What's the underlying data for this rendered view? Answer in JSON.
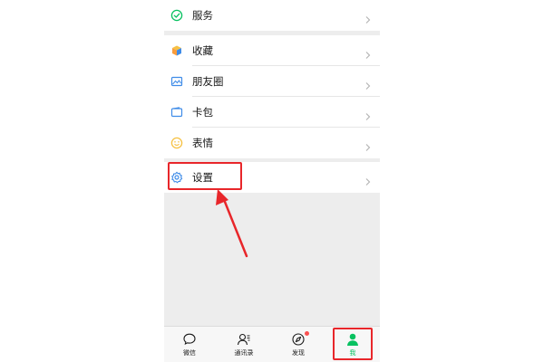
{
  "menu": {
    "group1": [
      {
        "label": "服务",
        "icon": "check-circle-icon"
      }
    ],
    "group2": [
      {
        "label": "收藏",
        "icon": "cube-icon"
      },
      {
        "label": "朋友圈",
        "icon": "image-icon"
      },
      {
        "label": "卡包",
        "icon": "wallet-icon"
      },
      {
        "label": "表情",
        "icon": "smiley-icon"
      }
    ],
    "group3": [
      {
        "label": "设置",
        "icon": "gear-icon"
      }
    ]
  },
  "tabbar": {
    "tabs": [
      {
        "label": "微信",
        "icon": "chat-bubble-icon",
        "active": false
      },
      {
        "label": "通讯录",
        "icon": "contacts-icon",
        "active": false
      },
      {
        "label": "发现",
        "icon": "compass-icon",
        "active": false,
        "badge": true
      },
      {
        "label": "我",
        "icon": "person-icon",
        "active": true
      }
    ]
  },
  "colors": {
    "accent_green": "#07c160",
    "annotation_red": "#e8262a",
    "background_gray": "#ededed"
  }
}
